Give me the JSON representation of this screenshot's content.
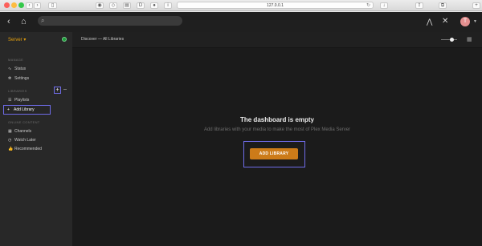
{
  "browser": {
    "url": "127.0.0.1",
    "icons": [
      "back-icon",
      "forward-icon",
      "sidebar-icon",
      "shield-icon",
      "share-icon",
      "reader-icon",
      "pin-icon",
      "info-icon"
    ]
  },
  "topbar": {
    "search_placeholder": "",
    "avatar_initial": "T",
    "icons": [
      "back-icon",
      "home-icon",
      "search-icon",
      "activity-icon",
      "settings-wrench-icon"
    ]
  },
  "sidebar": {
    "server_label": "Server",
    "server_status_color": "#1d9d3a",
    "manage_header": "MANAGE",
    "manage_items": [
      {
        "label": "Status",
        "icon": "pulse-icon"
      },
      {
        "label": "Settings",
        "icon": "gear-icon"
      }
    ],
    "libraries_header": "LIBRARIES",
    "library_items": [
      {
        "label": "Playlists",
        "icon": "playlist-icon"
      },
      {
        "label": "Add Library",
        "icon": "plus-icon"
      }
    ],
    "online_header": "ONLINE CONTENT",
    "online_items": [
      {
        "label": "Channels",
        "icon": "grid-icon"
      },
      {
        "label": "Watch Later",
        "icon": "clock-icon"
      },
      {
        "label": "Recommended",
        "icon": "thumbs-up-icon"
      }
    ]
  },
  "main": {
    "breadcrumb": "Discover — All Libraries",
    "empty_title": "The dashboard is empty",
    "empty_subtitle": "Add libraries with your media to make the most of Plex Media Server",
    "add_library_button": "ADD LIBRARY"
  },
  "colors": {
    "accent": "#e5a00d",
    "button": "#cc7b19",
    "highlight": "#6f6ce9"
  }
}
